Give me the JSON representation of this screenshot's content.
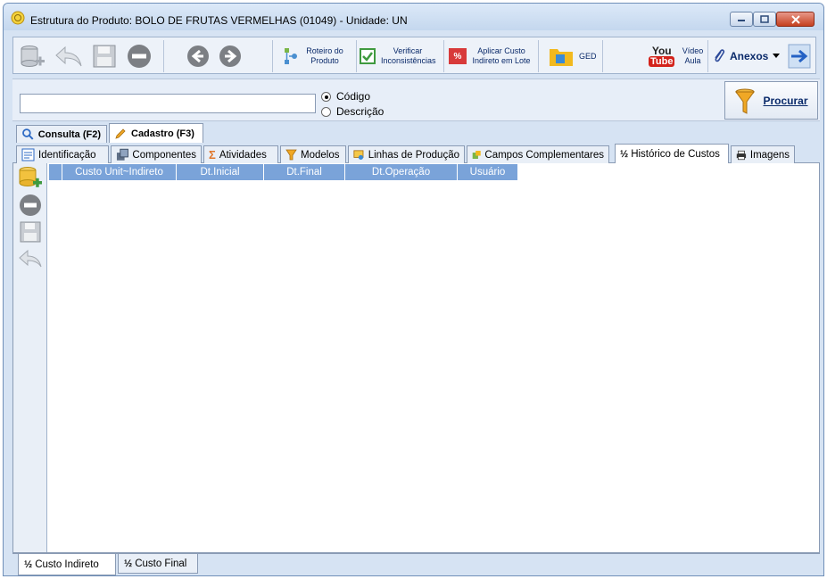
{
  "window": {
    "title": "Estrutura do Produto: BOLO DE FRUTAS VERMELHAS  (01049)   - Unidade: UN"
  },
  "toolbar": {
    "roteiro_label": "Roteiro do Produto",
    "verificar_label": "Verificar Inconsistências",
    "aplicar_label": "Aplicar Custo Indireto em Lote",
    "aplicar_badge": "%",
    "ged_label": "GED",
    "youtube_top": "You",
    "youtube_bottom": "Tube",
    "video_label": "Vídeo Aula",
    "anexos_label": "Anexos"
  },
  "search": {
    "value": "",
    "option_codigo": "Código",
    "option_descricao": "Descrição",
    "selected": "Código",
    "procurar_label": "Procurar"
  },
  "main_tabs": [
    {
      "label": "Consulta (F2)"
    },
    {
      "label": "Cadastro (F3)"
    }
  ],
  "sub_tabs": [
    {
      "label": "Identificação"
    },
    {
      "label": "Componentes"
    },
    {
      "label": "Atividades"
    },
    {
      "label": "Modelos"
    },
    {
      "label": "Linhas de Produção"
    },
    {
      "label": "Campos Complementares"
    },
    {
      "label": "Histórico de Custos"
    },
    {
      "label": "Imagens"
    }
  ],
  "grid": {
    "columns": [
      "Custo Unit~Indireto",
      "Dt.Inicial",
      "Dt.Final",
      "Dt.Operação",
      "Usuário"
    ],
    "rows": []
  },
  "bottom_tabs": [
    {
      "label": "Custo Indireto"
    },
    {
      "label": "Custo Final"
    }
  ],
  "icons": {
    "half_glyph": "½"
  },
  "colors": {
    "grid_header": "#7aa3d9",
    "window_frame": "#d6e3f3",
    "link_text": "#0a2a6a"
  }
}
